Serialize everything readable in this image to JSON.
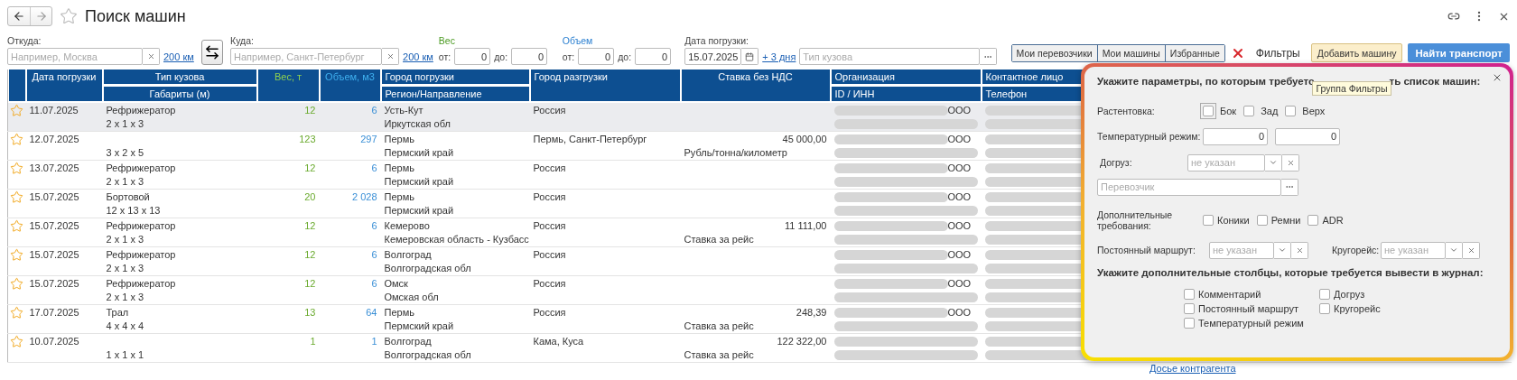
{
  "title": "Поиск машин",
  "filters": {
    "from": {
      "label": "Откуда:",
      "placeholder": "Например, Москва",
      "radius": "200 км"
    },
    "to": {
      "label": "Куда:",
      "placeholder": "Например, Санкт-Петербург",
      "radius": "200 км"
    },
    "weight": {
      "label": "Вес",
      "from_label": "от:",
      "from": "0",
      "to_label": "до:",
      "to": "0"
    },
    "volume": {
      "label": "Объем",
      "from_label": "от:",
      "from": "0",
      "to_label": "до:",
      "to": "0"
    },
    "date": {
      "label": "Дата погрузки:",
      "value": "15.07.2025",
      "plus": "+ 3 дня"
    },
    "body_type": {
      "placeholder": "Тип кузова"
    }
  },
  "toggle_buttons": [
    "Мои перевозчики",
    "Мои машины",
    "Избранные"
  ],
  "filters_button": "Фильтры",
  "add_button": "Добавить машину",
  "find_button": "Найти транспорт",
  "table": {
    "columns": [
      {
        "kind": "date",
        "title": "Дата погрузки"
      },
      {
        "kind": "body",
        "title": "Тип кузова",
        "subtitle": "Габариты (м)"
      },
      {
        "kind": "weight",
        "title": "Вес, т"
      },
      {
        "kind": "volume",
        "title": "Объем, м3"
      },
      {
        "kind": "load",
        "title": "Город погрузки",
        "subtitle": "Регион/Направление"
      },
      {
        "kind": "unload",
        "title": "Город разгрузки"
      },
      {
        "kind": "rate",
        "title": "Ставка без НДС"
      },
      {
        "kind": "org",
        "title": "Организация",
        "subtitle": "ID / ИНН"
      },
      {
        "kind": "contact",
        "title": "Контактное лицо",
        "subtitle": "Телефон"
      }
    ],
    "rows": [
      {
        "selected": true,
        "date": "11.07.2025",
        "body_type": "Рефрижератор",
        "dims": "2 x 1 x 3",
        "weight": "12",
        "volume": "6",
        "load_city": "Усть-Кут",
        "load_region": "Иркутская обл",
        "unload_city": "Россия",
        "org_suffix": "ООО"
      },
      {
        "selected": false,
        "date": "12.07.2025",
        "dims": "3 x 2 x 5",
        "weight": "123",
        "volume": "297",
        "load_city": "Пермь",
        "load_region": "Пермский край",
        "unload_city": "Пермь, Санкт-Петербург",
        "rate": "45 000,00",
        "rate_unit": "Рубль/тонна/километр",
        "org_suffix": "ООО"
      },
      {
        "selected": false,
        "date": "13.07.2025",
        "body_type": "Рефрижератор",
        "dims": "2 x 1 x 3",
        "weight": "12",
        "volume": "6",
        "load_city": "Пермь",
        "load_region": "Пермский край",
        "unload_city": "Россия",
        "org_suffix": "ООО"
      },
      {
        "selected": false,
        "date": "15.07.2025",
        "body_type": "Бортовой",
        "dims": "12 x 13 x 13",
        "weight": "20",
        "volume": "2 028",
        "load_city": "Пермь",
        "load_region": "Пермский край",
        "unload_city": "Россия",
        "org_suffix": "ООО"
      },
      {
        "selected": false,
        "date": "15.07.2025",
        "body_type": "Рефрижератор",
        "dims": "2 x 1 x 3",
        "weight": "12",
        "volume": "6",
        "load_city": "Кемерово",
        "load_region": "Кемеровская область - Кузбасс",
        "unload_city": "Россия",
        "rate": "11 111,00",
        "rate_unit": "Ставка за рейс",
        "org_suffix": "ООО"
      },
      {
        "selected": false,
        "date": "15.07.2025",
        "body_type": "Рефрижератор",
        "dims": "2 x 1 x 3",
        "weight": "12",
        "volume": "6",
        "load_city": "Волгоград",
        "load_region": "Волгоградская обл",
        "unload_city": "Россия",
        "org_suffix": "ООО"
      },
      {
        "selected": false,
        "date": "15.07.2025",
        "body_type": "Рефрижератор",
        "dims": "2 x 1 x 3",
        "weight": "12",
        "volume": "6",
        "load_city": "Омск",
        "load_region": "Омская обл",
        "unload_city": "Россия",
        "org_suffix": "ООО"
      },
      {
        "selected": false,
        "date": "17.07.2025",
        "body_type": "Трал",
        "dims": "4 x 4 x 4",
        "weight": "13",
        "volume": "64",
        "load_city": "Пермь",
        "load_region": "Пермский край",
        "unload_city": "Россия",
        "rate": "248,39",
        "rate_unit": "Ставка за рейс",
        "org_suffix": "ООО"
      },
      {
        "selected": false,
        "date": "10.07.2025",
        "dims": "1 x 1 x 1",
        "weight": "1",
        "volume": "1",
        "load_city": "Волгоград",
        "load_region": "Волгоградская обл",
        "unload_city": "Кама, Куса",
        "rate": "122 322,00",
        "rate_unit": "Ставка за рейс"
      }
    ],
    "footer_link": "Досье контрагента"
  },
  "filter_popup": {
    "heading_start": "Укажите параметры, по которым требуетс",
    "heading_end": "ть список машин:",
    "tooltip": "Группа Фильтры",
    "tenting": {
      "label": "Растентовка:",
      "options": [
        {
          "label": "Бок",
          "checked": false,
          "focused": true
        },
        {
          "label": "Зад",
          "checked": false,
          "focused": false
        },
        {
          "label": "Верх",
          "checked": false,
          "focused": false
        }
      ]
    },
    "temperature": {
      "label": "Температурный режим:",
      "from": "0",
      "to": "0"
    },
    "reload": {
      "label": "Догруз:",
      "placeholder": "не указан"
    },
    "carrier": {
      "placeholder": "Перевозчик"
    },
    "requirements": {
      "label": "Дополнительные требования:",
      "options": [
        {
          "label": "Коники",
          "checked": false
        },
        {
          "label": "Ремни",
          "checked": false
        },
        {
          "label": "ADR",
          "checked": false
        }
      ]
    },
    "route": {
      "label": "Постоянный маршрут:",
      "placeholder": "не указан"
    },
    "round_trip": {
      "label": "Кругорейс:",
      "placeholder": "не указан"
    },
    "columns_heading": "Укажите дополнительные столбцы, которые требуется вывести в журнал:",
    "extra_columns": [
      {
        "label": "Комментарий",
        "checked": false
      },
      {
        "label": "Догруз",
        "checked": false
      },
      {
        "label": "Постоянный маршрут",
        "checked": false
      },
      {
        "label": "Кругорейс",
        "checked": false
      },
      {
        "label": "Температурный режим",
        "checked": false
      }
    ]
  }
}
